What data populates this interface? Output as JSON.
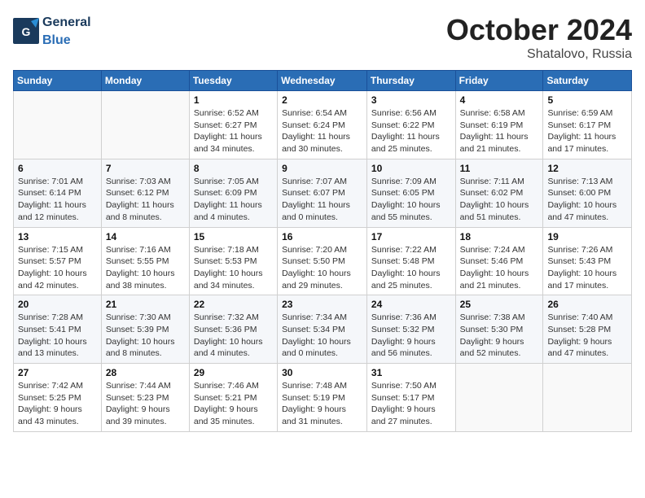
{
  "header": {
    "logo_general": "General",
    "logo_blue": "Blue",
    "month": "October 2024",
    "location": "Shatalovo, Russia"
  },
  "weekdays": [
    "Sunday",
    "Monday",
    "Tuesday",
    "Wednesday",
    "Thursday",
    "Friday",
    "Saturday"
  ],
  "weeks": [
    [
      {
        "day": "",
        "info": ""
      },
      {
        "day": "",
        "info": ""
      },
      {
        "day": "1",
        "info": "Sunrise: 6:52 AM\nSunset: 6:27 PM\nDaylight: 11 hours\nand 34 minutes."
      },
      {
        "day": "2",
        "info": "Sunrise: 6:54 AM\nSunset: 6:24 PM\nDaylight: 11 hours\nand 30 minutes."
      },
      {
        "day": "3",
        "info": "Sunrise: 6:56 AM\nSunset: 6:22 PM\nDaylight: 11 hours\nand 25 minutes."
      },
      {
        "day": "4",
        "info": "Sunrise: 6:58 AM\nSunset: 6:19 PM\nDaylight: 11 hours\nand 21 minutes."
      },
      {
        "day": "5",
        "info": "Sunrise: 6:59 AM\nSunset: 6:17 PM\nDaylight: 11 hours\nand 17 minutes."
      }
    ],
    [
      {
        "day": "6",
        "info": "Sunrise: 7:01 AM\nSunset: 6:14 PM\nDaylight: 11 hours\nand 12 minutes."
      },
      {
        "day": "7",
        "info": "Sunrise: 7:03 AM\nSunset: 6:12 PM\nDaylight: 11 hours\nand 8 minutes."
      },
      {
        "day": "8",
        "info": "Sunrise: 7:05 AM\nSunset: 6:09 PM\nDaylight: 11 hours\nand 4 minutes."
      },
      {
        "day": "9",
        "info": "Sunrise: 7:07 AM\nSunset: 6:07 PM\nDaylight: 11 hours\nand 0 minutes."
      },
      {
        "day": "10",
        "info": "Sunrise: 7:09 AM\nSunset: 6:05 PM\nDaylight: 10 hours\nand 55 minutes."
      },
      {
        "day": "11",
        "info": "Sunrise: 7:11 AM\nSunset: 6:02 PM\nDaylight: 10 hours\nand 51 minutes."
      },
      {
        "day": "12",
        "info": "Sunrise: 7:13 AM\nSunset: 6:00 PM\nDaylight: 10 hours\nand 47 minutes."
      }
    ],
    [
      {
        "day": "13",
        "info": "Sunrise: 7:15 AM\nSunset: 5:57 PM\nDaylight: 10 hours\nand 42 minutes."
      },
      {
        "day": "14",
        "info": "Sunrise: 7:16 AM\nSunset: 5:55 PM\nDaylight: 10 hours\nand 38 minutes."
      },
      {
        "day": "15",
        "info": "Sunrise: 7:18 AM\nSunset: 5:53 PM\nDaylight: 10 hours\nand 34 minutes."
      },
      {
        "day": "16",
        "info": "Sunrise: 7:20 AM\nSunset: 5:50 PM\nDaylight: 10 hours\nand 29 minutes."
      },
      {
        "day": "17",
        "info": "Sunrise: 7:22 AM\nSunset: 5:48 PM\nDaylight: 10 hours\nand 25 minutes."
      },
      {
        "day": "18",
        "info": "Sunrise: 7:24 AM\nSunset: 5:46 PM\nDaylight: 10 hours\nand 21 minutes."
      },
      {
        "day": "19",
        "info": "Sunrise: 7:26 AM\nSunset: 5:43 PM\nDaylight: 10 hours\nand 17 minutes."
      }
    ],
    [
      {
        "day": "20",
        "info": "Sunrise: 7:28 AM\nSunset: 5:41 PM\nDaylight: 10 hours\nand 13 minutes."
      },
      {
        "day": "21",
        "info": "Sunrise: 7:30 AM\nSunset: 5:39 PM\nDaylight: 10 hours\nand 8 minutes."
      },
      {
        "day": "22",
        "info": "Sunrise: 7:32 AM\nSunset: 5:36 PM\nDaylight: 10 hours\nand 4 minutes."
      },
      {
        "day": "23",
        "info": "Sunrise: 7:34 AM\nSunset: 5:34 PM\nDaylight: 10 hours\nand 0 minutes."
      },
      {
        "day": "24",
        "info": "Sunrise: 7:36 AM\nSunset: 5:32 PM\nDaylight: 9 hours\nand 56 minutes."
      },
      {
        "day": "25",
        "info": "Sunrise: 7:38 AM\nSunset: 5:30 PM\nDaylight: 9 hours\nand 52 minutes."
      },
      {
        "day": "26",
        "info": "Sunrise: 7:40 AM\nSunset: 5:28 PM\nDaylight: 9 hours\nand 47 minutes."
      }
    ],
    [
      {
        "day": "27",
        "info": "Sunrise: 7:42 AM\nSunset: 5:25 PM\nDaylight: 9 hours\nand 43 minutes."
      },
      {
        "day": "28",
        "info": "Sunrise: 7:44 AM\nSunset: 5:23 PM\nDaylight: 9 hours\nand 39 minutes."
      },
      {
        "day": "29",
        "info": "Sunrise: 7:46 AM\nSunset: 5:21 PM\nDaylight: 9 hours\nand 35 minutes."
      },
      {
        "day": "30",
        "info": "Sunrise: 7:48 AM\nSunset: 5:19 PM\nDaylight: 9 hours\nand 31 minutes."
      },
      {
        "day": "31",
        "info": "Sunrise: 7:50 AM\nSunset: 5:17 PM\nDaylight: 9 hours\nand 27 minutes."
      },
      {
        "day": "",
        "info": ""
      },
      {
        "day": "",
        "info": ""
      }
    ]
  ]
}
